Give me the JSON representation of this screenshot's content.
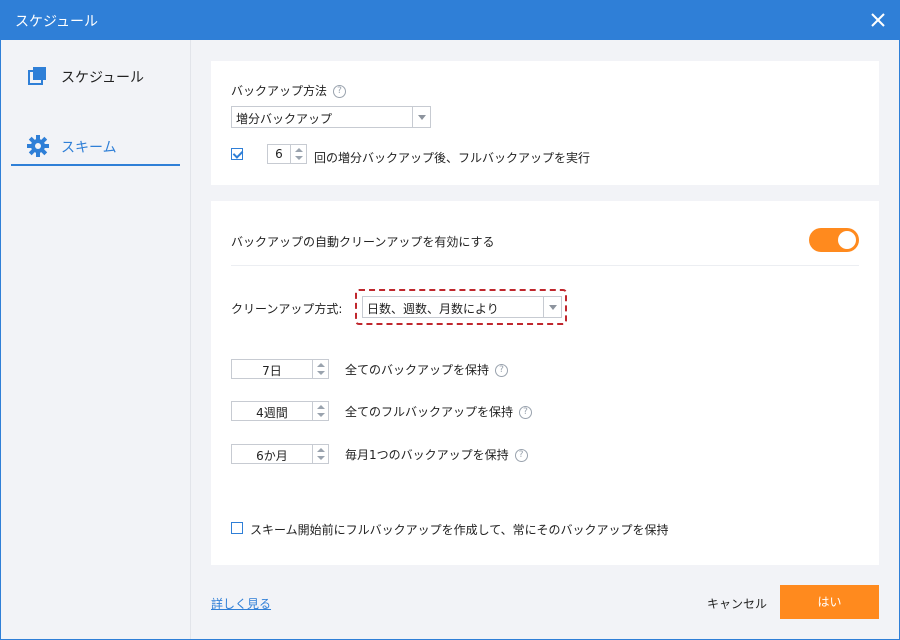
{
  "window": {
    "title": "スケジュール"
  },
  "sidebar": {
    "items": [
      {
        "label": "スケジュール",
        "active": false
      },
      {
        "label": "スキーム",
        "active": true
      }
    ]
  },
  "backup_method": {
    "label": "バックアップ方法",
    "selected": "増分バックアップ",
    "checkbox_checked": true,
    "full_interval": "6",
    "full_interval_text": "回の増分バックアップ後、フルバックアップを実行"
  },
  "cleanup": {
    "toggle_label": "バックアップの自動クリーンアップを有効にする",
    "enabled": true,
    "method_label": "クリーンアップ方式:",
    "method_selected": "日数、週数、月数により",
    "rules": [
      {
        "value": "7日",
        "text": "全てのバックアップを保持"
      },
      {
        "value": "4週間",
        "text": "全てのフルバックアップを保持"
      },
      {
        "value": "6か月",
        "text": "毎月1つのバックアップを保持"
      }
    ],
    "pre_full_checked": false,
    "pre_full_text": "スキーム開始前にフルバックアップを作成して、常にそのバックアップを保持"
  },
  "footer": {
    "learn_more": "詳しく見る",
    "cancel": "キャンセル",
    "ok": "はい"
  },
  "colors": {
    "accent": "#2f7fd7",
    "orange": "#ff8a1e",
    "highlight": "#c0272d"
  }
}
